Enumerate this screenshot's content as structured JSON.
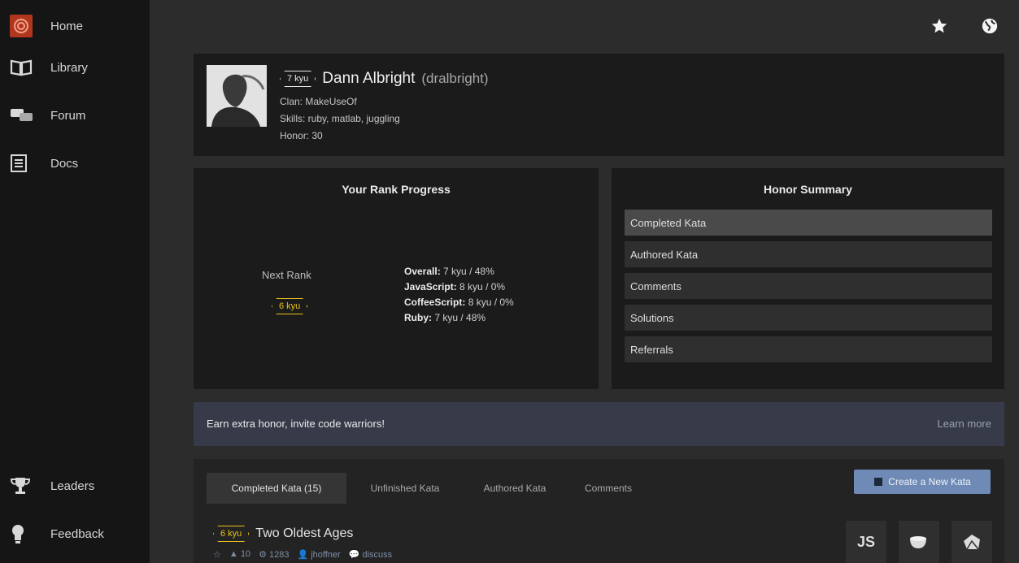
{
  "sidebar": {
    "top_items": [
      {
        "label": "Home",
        "icon": "codewars-logo-icon"
      },
      {
        "label": "Library",
        "icon": "book-icon"
      },
      {
        "label": "Forum",
        "icon": "chat-bubbles-icon"
      },
      {
        "label": "Docs",
        "icon": "document-icon"
      }
    ],
    "bottom_items": [
      {
        "label": "Leaders",
        "icon": "trophy-icon"
      },
      {
        "label": "Feedback",
        "icon": "lightbulb-icon"
      }
    ]
  },
  "topbar": {
    "icons": [
      "star-icon",
      "globe-icon"
    ]
  },
  "profile": {
    "rank": "7 kyu",
    "name": "Dann Albright",
    "username": "(dralbright)",
    "clan": "Clan: MakeUseOf",
    "skills": "Skills: ruby, matlab, juggling",
    "honor": "Honor: 30"
  },
  "rank_progress": {
    "title": "Your Rank Progress",
    "next_rank_label": "Next Rank",
    "next_rank": "6 kyu",
    "lines": [
      {
        "label": "Overall:",
        "value": "7 kyu / 48%"
      },
      {
        "label": "JavaScript:",
        "value": "8 kyu / 0%"
      },
      {
        "label": "CoffeeScript:",
        "value": "8 kyu / 0%"
      },
      {
        "label": "Ruby:",
        "value": "7 kyu / 48%"
      }
    ]
  },
  "honor_summary": {
    "title": "Honor Summary",
    "rows": [
      "Completed Kata",
      "Authored Kata",
      "Comments",
      "Solutions",
      "Referrals"
    ]
  },
  "invite": {
    "message": "Earn extra honor, invite code warriors!",
    "link": "Learn more"
  },
  "kata": {
    "tabs": [
      "Completed Kata (15)",
      "Unfinished Kata",
      "Authored Kata",
      "Comments"
    ],
    "create_button": "Create a New Kata",
    "item": {
      "rank": "6 kyu",
      "title": "Two Oldest Ages",
      "stats": [
        "☆",
        "▲ 10",
        "⚙ 1283",
        "👤 jhoffner",
        "💬 discuss"
      ],
      "languages": [
        "JS",
        "coffeescript-icon",
        "ruby-icon"
      ]
    }
  },
  "colors": {
    "sidebar_bg": "#151515",
    "panel_bg": "#1b1b1b",
    "brand_red": "#b1361e",
    "rank_yellow": "#e8c21c",
    "button_blue": "#6e8ab5"
  }
}
